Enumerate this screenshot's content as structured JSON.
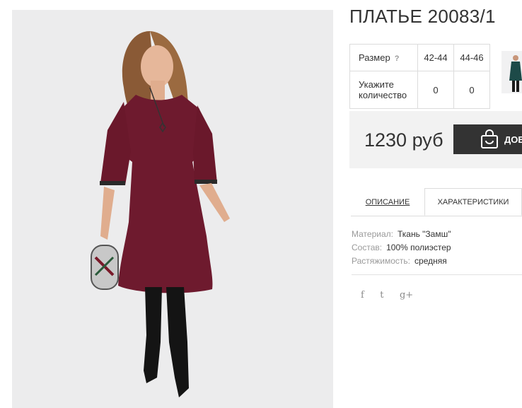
{
  "product": {
    "title": "ПЛАТЬЕ 20083/1",
    "image_alt": "Женщина в бордовом платье и черных ботфортах"
  },
  "size_table": {
    "size_label": "Размер",
    "help_icon": "?",
    "sizes": [
      "42-44",
      "44-46"
    ],
    "quantity_label": "Укажите количество",
    "quantities": [
      "0",
      "0"
    ]
  },
  "price_box": {
    "price": "1230 руб",
    "add_button_label": "ДОБ"
  },
  "tabs": {
    "description": "ОПИСАНИЕ",
    "characteristics": "ХАРАКТЕРИСТИКИ"
  },
  "specs": [
    {
      "key": "Материал:",
      "value": "Ткань \"Замш\""
    },
    {
      "key": "Состав:",
      "value": "100% полиэстер"
    },
    {
      "key": "Растяжимость:",
      "value": "средняя"
    }
  ],
  "social": {
    "facebook": "f",
    "twitter": "t",
    "google": "g+"
  },
  "colors": {
    "dress": "#6e1a2e",
    "button": "#333333",
    "price_bg": "#f2f2f2",
    "photo_bg": "#ececed"
  }
}
